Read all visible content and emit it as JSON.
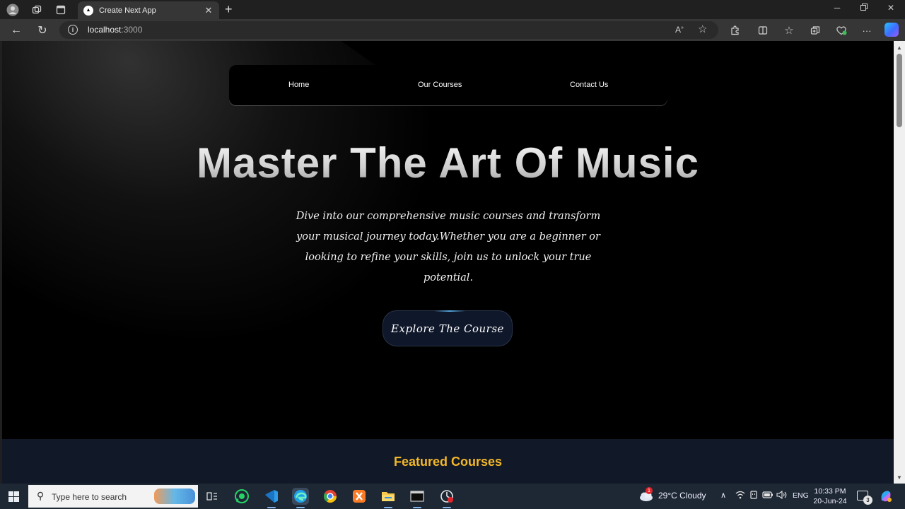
{
  "browser": {
    "tab_title": "Create Next App",
    "tab_favicon": "▲",
    "url_host": "localhost",
    "url_port": ":3000"
  },
  "nav": {
    "links": [
      "Home",
      "Our Courses",
      "Contact Us"
    ]
  },
  "hero": {
    "title": "Master The Art Of Music",
    "subtitle": "Dive into our comprehensive music courses and transform your musical journey today.Whether you are a beginner or looking to refine your skills, join us to unlock your true potential.",
    "cta_label": "Explore The Course"
  },
  "featured": {
    "title": "Featured Courses"
  },
  "taskbar": {
    "search_placeholder": "Type here to search",
    "weather": "29°C  Cloudy",
    "weather_badge": "1",
    "language": "ENG",
    "time": "10:33 PM",
    "date": "20-Jun-24",
    "notification_count": "3"
  },
  "colors": {
    "accent_featured": "#f3b829",
    "featured_bg": "#111827",
    "cta_bg": "#0f172a"
  },
  "icons": {
    "toolbar": [
      "back-arrow-icon",
      "refresh-icon",
      "info-icon",
      "read-aloud-icon",
      "favorite-star-icon",
      "extensions-icon",
      "split-screen-icon",
      "favorites-icon",
      "collections-icon",
      "browser-essentials-icon",
      "more-icon",
      "copilot-icon"
    ]
  }
}
